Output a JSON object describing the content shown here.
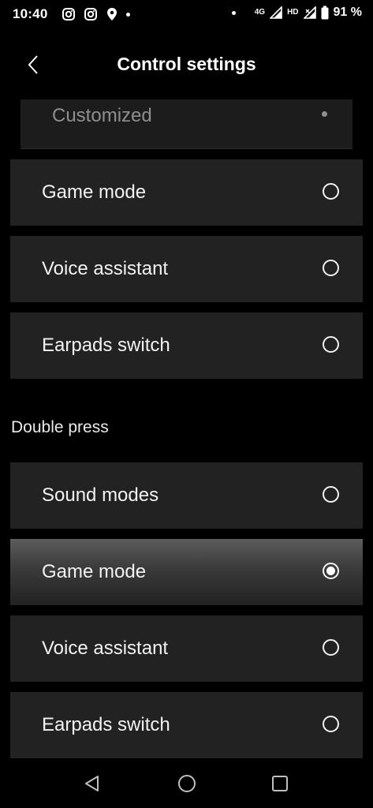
{
  "status_bar": {
    "time": "10:40",
    "network": "4G",
    "hd": "HD",
    "battery": "91 %",
    "icons": [
      "instagram-icon",
      "instagram-icon",
      "location-icon",
      "dot-icon",
      "dot-icon",
      "signal-icon",
      "signal-icon",
      "battery-icon"
    ]
  },
  "header": {
    "title": "Control settings"
  },
  "customized": {
    "label": "Customized"
  },
  "single_press_options": [
    {
      "label": "Game mode",
      "selected": false
    },
    {
      "label": "Voice assistant",
      "selected": false
    },
    {
      "label": "Earpads switch",
      "selected": false
    }
  ],
  "double_press": {
    "title": "Double press",
    "options": [
      {
        "label": "Sound modes",
        "selected": false
      },
      {
        "label": "Game mode",
        "selected": true
      },
      {
        "label": "Voice assistant",
        "selected": false
      },
      {
        "label": "Earpads switch",
        "selected": false
      }
    ]
  },
  "colors": {
    "background": "#000000",
    "row": "#222222",
    "text": "#f2f2f2",
    "muted": "#8f8f8f"
  }
}
